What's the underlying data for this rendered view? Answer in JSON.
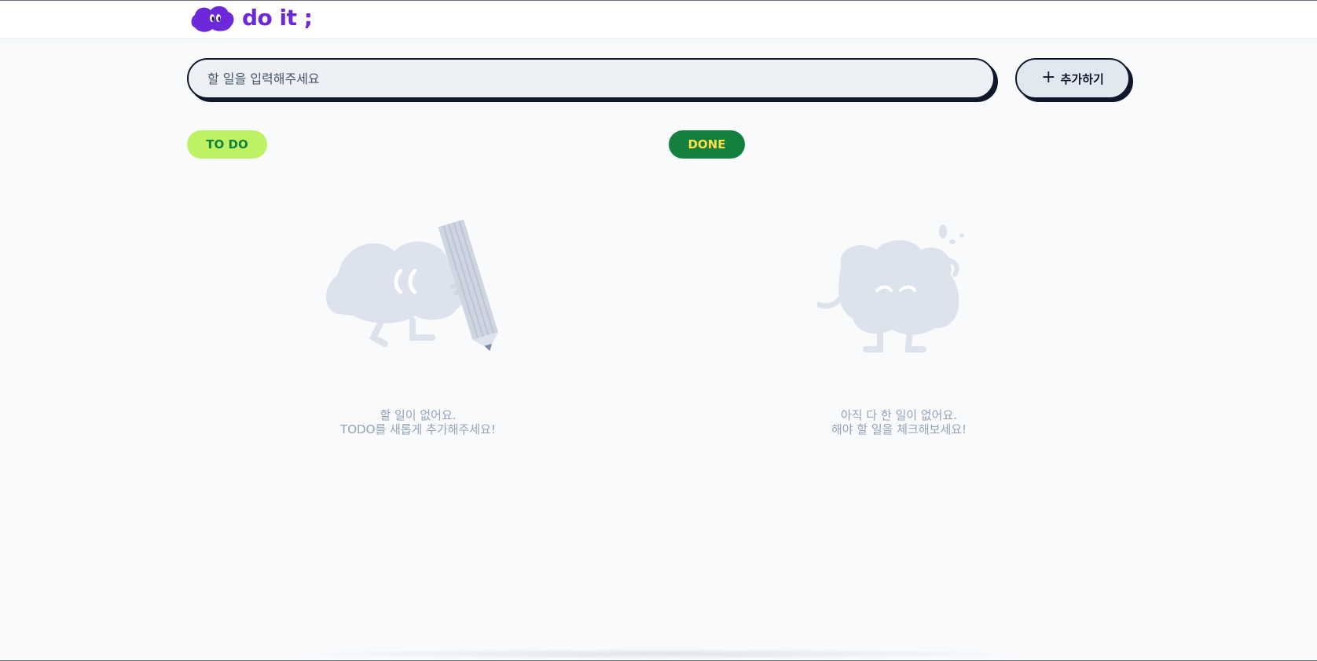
{
  "app": {
    "logo_text": "do it ;",
    "brand_color": "#6d28d9"
  },
  "search": {
    "placeholder": "할 일을 입력해주세요",
    "value": ""
  },
  "actions": {
    "add_label": "추가하기",
    "add_icon": "plus-icon"
  },
  "sections": {
    "todo": {
      "badge": "TO DO",
      "badge_bg": "#bef264",
      "badge_fg": "#15803d",
      "empty_line1": "할 일이 없어요.",
      "empty_line2": "TODO를 새롭게 추가해주세요!"
    },
    "done": {
      "badge": "DONE",
      "badge_bg": "#15803d",
      "badge_fg": "#fde047",
      "empty_line1": "아직 다 한 일이 없어요.",
      "empty_line2": "해야 할 일을 체크해보세요!"
    }
  }
}
